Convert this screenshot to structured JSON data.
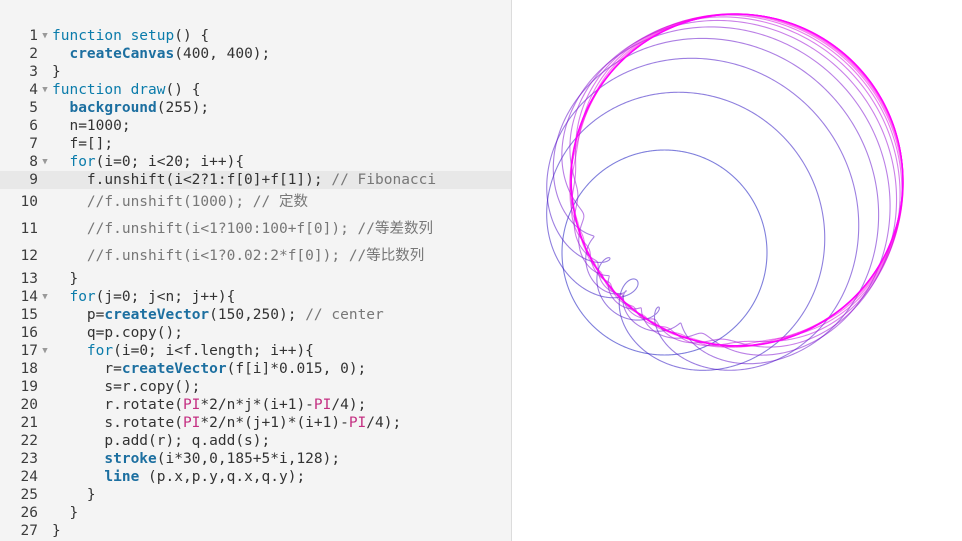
{
  "editor": {
    "lines": [
      {
        "num": "1",
        "fold": true,
        "html": "<span class='k'>function</span> <span class='k'>setup</span>() {"
      },
      {
        "num": "2",
        "fold": false,
        "html": "  <span class='f'>createCanvas</span>(400, 400);"
      },
      {
        "num": "3",
        "fold": false,
        "html": "}"
      },
      {
        "num": "4",
        "fold": true,
        "html": "<span class='k'>function</span> <span class='k'>draw</span>() {"
      },
      {
        "num": "5",
        "fold": false,
        "html": "  <span class='f'>background</span>(255);"
      },
      {
        "num": "6",
        "fold": false,
        "html": "  n=1000;"
      },
      {
        "num": "7",
        "fold": false,
        "html": "  f=[];"
      },
      {
        "num": "8",
        "fold": true,
        "html": "  <span class='k'>for</span>(i=0; i&lt;20; i++){"
      },
      {
        "num": "9",
        "fold": false,
        "active": true,
        "html": "    f.unshift(i&lt;2?1:f[0]+f[1]); <span class='c'>// Fibonacci</span>"
      },
      {
        "num": "10",
        "fold": false,
        "tall": true,
        "html": "    <span class='c'>//f.unshift(1000); // 定数</span>"
      },
      {
        "num": "11",
        "fold": false,
        "tall": true,
        "html": "    <span class='c'>//f.unshift(i&lt;1?100:100+f[0]); //等差数列</span>"
      },
      {
        "num": "12",
        "fold": false,
        "tall": true,
        "html": "    <span class='c'>//f.unshift(i&lt;1?0.02:2*f[0]); //等比数列</span>"
      },
      {
        "num": "13",
        "fold": false,
        "html": "  }"
      },
      {
        "num": "14",
        "fold": true,
        "html": "  <span class='k'>for</span>(j=0; j&lt;n; j++){"
      },
      {
        "num": "15",
        "fold": false,
        "html": "    p=<span class='f'>createVector</span>(150,250); <span class='c'>// center</span>"
      },
      {
        "num": "16",
        "fold": false,
        "html": "    q=p.copy();"
      },
      {
        "num": "17",
        "fold": true,
        "html": "    <span class='k'>for</span>(i=0; i&lt;f.length; i++){"
      },
      {
        "num": "18",
        "fold": false,
        "html": "      r=<span class='f'>createVector</span>(f[i]*0.015, 0);"
      },
      {
        "num": "19",
        "fold": false,
        "html": "      s=r.copy();"
      },
      {
        "num": "20",
        "fold": false,
        "html": "      r.rotate(<span class='pi'>PI</span>*2/n*j*(i+1)-<span class='pi'>PI</span>/4);"
      },
      {
        "num": "21",
        "fold": false,
        "html": "      s.rotate(<span class='pi'>PI</span>*2/n*(j+1)*(i+1)-<span class='pi'>PI</span>/4);"
      },
      {
        "num": "22",
        "fold": false,
        "html": "      p.add(r); q.add(s);"
      },
      {
        "num": "23",
        "fold": false,
        "html": "      <span class='f'>stroke</span>(i*30,0,185+5*i,128);"
      },
      {
        "num": "24",
        "fold": false,
        "html": "      <span class='f'>line</span> (p.x,p.y,q.x,q.y);"
      },
      {
        "num": "25",
        "fold": false,
        "html": "    }"
      },
      {
        "num": "26",
        "fold": false,
        "html": "  }"
      },
      {
        "num": "27",
        "fold": false,
        "html": "}"
      }
    ],
    "fold_glyph": "▼"
  },
  "colors": {
    "circle_stroke_base": "#7a5cd6",
    "circle_stroke_hot": "#e010e0"
  }
}
